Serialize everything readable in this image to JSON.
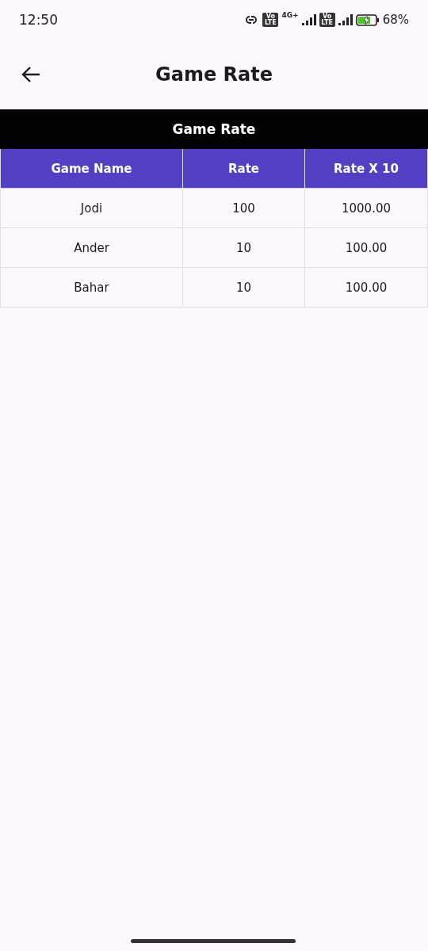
{
  "status_bar": {
    "time": "12:50",
    "network": "4G+",
    "volte_badges": [
      "Vo LTE",
      "Vo LTE"
    ],
    "battery": "68%"
  },
  "header": {
    "title": "Game Rate"
  },
  "table": {
    "caption": "Game Rate",
    "columns": [
      "Game Name",
      "Rate",
      "Rate X 10"
    ],
    "rows": [
      [
        "Jodi",
        "100",
        "1000.00"
      ],
      [
        "Ander",
        "10",
        "100.00"
      ],
      [
        "Bahar",
        "10",
        "100.00"
      ]
    ]
  }
}
